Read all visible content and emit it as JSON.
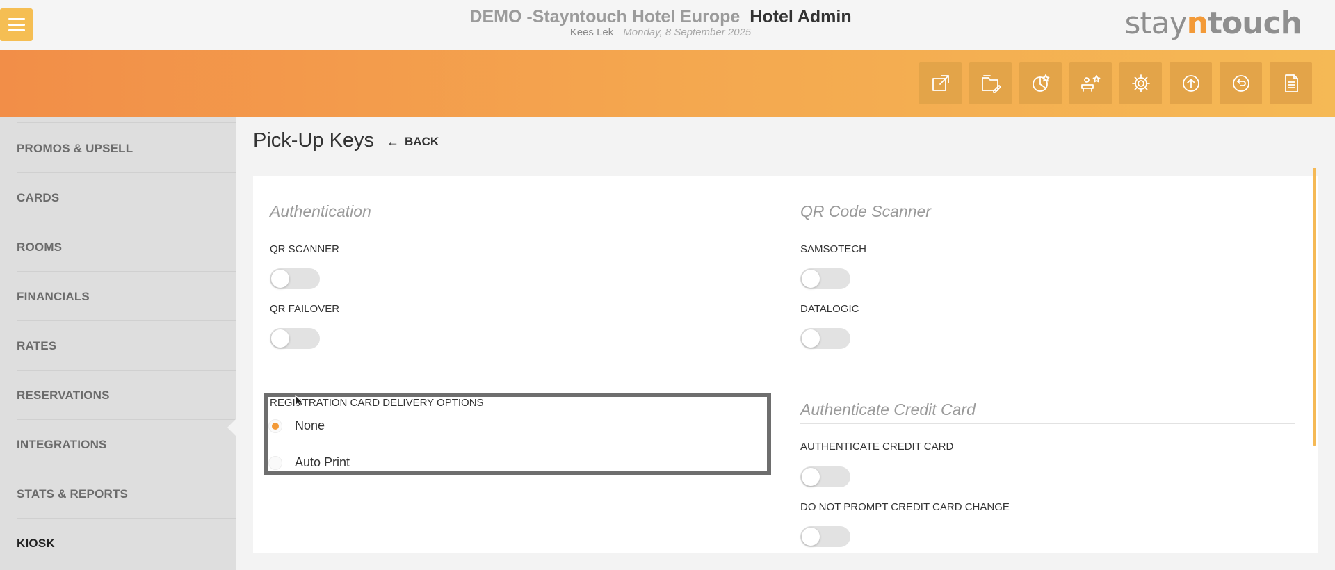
{
  "header": {
    "hotel_name": "DEMO -Stayntouch Hotel Europe",
    "admin_label": "Hotel Admin",
    "user_name": "Kees Lek",
    "date": "Monday, 8 September 2025",
    "logo": {
      "stay": "stay",
      "n": "n",
      "touch": "touch"
    },
    "menu_icon": "hamburger-icon"
  },
  "toolbar": {
    "icons": [
      "external-link-icon",
      "edit-folder-icon",
      "dashboard-icon",
      "guest-star-icon",
      "gear-icon",
      "upload-icon",
      "back-office-icon",
      "document-icon"
    ]
  },
  "sidebar": {
    "items": [
      {
        "label": "PROMOS & UPSELL"
      },
      {
        "label": "CARDS"
      },
      {
        "label": "ROOMS"
      },
      {
        "label": "FINANCIALS"
      },
      {
        "label": "RATES"
      },
      {
        "label": "RESERVATIONS"
      },
      {
        "label": "INTEGRATIONS"
      },
      {
        "label": "STATS & REPORTS"
      },
      {
        "label": "KIOSK"
      }
    ],
    "active": "KIOSK"
  },
  "page": {
    "title": "Pick-Up Keys",
    "back_label": "BACK"
  },
  "authentication": {
    "title": "Authentication",
    "qr_scanner_label": "QR SCANNER",
    "qr_scanner_on": false,
    "qr_failover_label": "QR FAILOVER",
    "qr_failover_on": false
  },
  "qr_code_scanner": {
    "title": "QR Code Scanner",
    "samsotech_label": "SAMSOTECH",
    "samsotech_on": false,
    "datalogic_label": "DATALOGIC",
    "datalogic_on": false
  },
  "registration_card": {
    "label": "REGISTRATION CARD DELIVERY OPTIONS",
    "options": [
      {
        "label": "None",
        "selected": true
      },
      {
        "label": "Auto Print",
        "selected": false
      }
    ]
  },
  "authenticate_credit_card": {
    "title": "Authenticate Credit Card",
    "authenticate_label": "AUTHENTICATE CREDIT CARD",
    "authenticate_on": false,
    "no_prompt_label": "DO NOT PROMPT CREDIT CARD CHANGE",
    "no_prompt_on": false
  },
  "colors": {
    "accent": "#f39a38",
    "toolbar_start": "#f28e48",
    "toolbar_end": "#f5b955",
    "tool_button": "#e3a449",
    "menu_button": "#f5be53"
  }
}
